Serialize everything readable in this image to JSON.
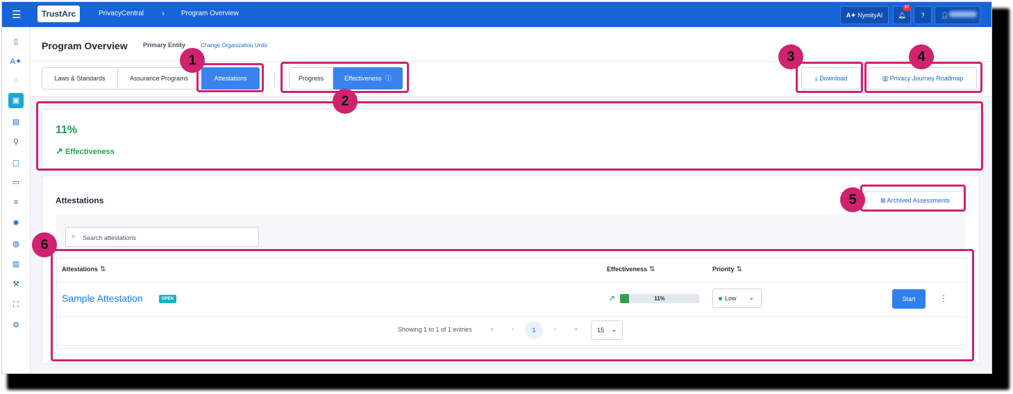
{
  "topbar": {
    "logo": "TrustArc",
    "breadcrumb": [
      "PrivacyCentral",
      "Program Overview"
    ],
    "breadcrumb_separator": "›",
    "nymity_label": "NymityAI",
    "notification_count": "97",
    "help_icon": "?"
  },
  "sidebar": {
    "icons": [
      "document-icon",
      "ai-icon",
      "bell-icon",
      "program-icon",
      "table-icon",
      "org-chart-icon",
      "clipboard-icon",
      "monitor-icon",
      "list-doc-icon",
      "globe-gear-icon",
      "globe-icon",
      "report-icon",
      "gavel-icon",
      "flow-icon",
      "settings-icon"
    ],
    "active_index": 3
  },
  "header": {
    "title": "Program Overview",
    "primary_entity": "Primary Entity",
    "change_units": "Change Organization Units"
  },
  "tabs": {
    "items": [
      "Laws & Standards",
      "Assurance Programs",
      "Attestations"
    ],
    "active": "Attestations"
  },
  "view_toggle": {
    "items": [
      "Progress",
      "Effectiveness"
    ],
    "active": "Effectiveness"
  },
  "actions": {
    "download": "Download",
    "roadmap": "Privacy Journey Roadmap"
  },
  "summary": {
    "percent": "11%",
    "label": "Effectiveness"
  },
  "attestations": {
    "title": "Attestations",
    "archived": "Archived Assessments",
    "search_placeholder": "Search attestations",
    "columns": {
      "name": "Attestations",
      "effectiveness": "Effectiveness",
      "priority": "Priority"
    },
    "sort_glyph": "⇅",
    "rows": [
      {
        "name": "Sample Attestation",
        "status": "OPEN",
        "effectiveness_label": "11%",
        "effectiveness_value": 0.11,
        "priority": "Low",
        "action": "Start"
      }
    ],
    "pagination": {
      "info": "Showing 1 to 1 of 1 entries",
      "first": "«",
      "prev": "‹",
      "current": "1",
      "next": "›",
      "last": "»",
      "page_size": "15"
    }
  },
  "markers": [
    "1",
    "2",
    "3",
    "4",
    "5",
    "6"
  ],
  "colors": {
    "accent": "#1665d8",
    "success": "#23a055",
    "annotation": "#d0226f"
  }
}
